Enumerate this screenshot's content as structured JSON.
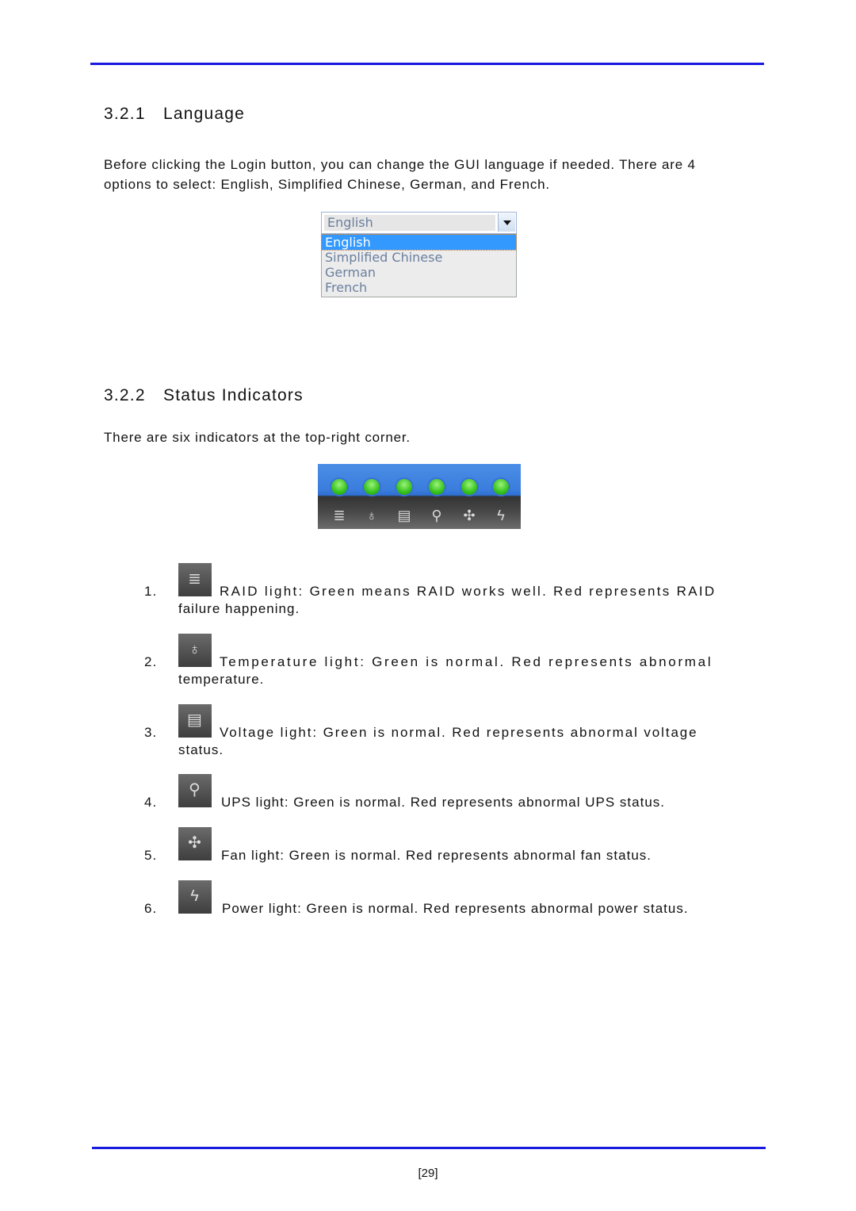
{
  "section_language": {
    "number": "3.2.1",
    "title": "Language",
    "paragraph": "Before clicking the Login button, you can change the GUI language if needed. There are 4 options to select: English, Simplified Chinese, German, and French.",
    "dropdown": {
      "selected": "English",
      "options": [
        "English",
        "Simplified Chinese",
        "German",
        "French"
      ],
      "highlighted_index": 0
    }
  },
  "section_status": {
    "number": "3.2.2",
    "title": "Status Indicators",
    "paragraph": "There are six indicators at the top-right corner.",
    "indicator_bar": {
      "lights": [
        {
          "name": "RAID",
          "icon": "raid-icon",
          "glyph": "≣",
          "status": "green"
        },
        {
          "name": "Temperature",
          "icon": "thermometer-icon",
          "glyph": "♁",
          "status": "green"
        },
        {
          "name": "Voltage",
          "icon": "battery-icon",
          "glyph": "▤",
          "status": "green"
        },
        {
          "name": "UPS",
          "icon": "plug-icon",
          "glyph": "⚲",
          "status": "green"
        },
        {
          "name": "Fan",
          "icon": "fan-icon",
          "glyph": "✣",
          "status": "green"
        },
        {
          "name": "Power",
          "icon": "power-icon",
          "glyph": "ϟ",
          "status": "green"
        }
      ],
      "colors": {
        "bar_blue": "#3a7ddd",
        "bar_dark": "#444444",
        "light_green": "#35c21b"
      }
    },
    "items": [
      {
        "number": "1.",
        "line1": "RAID light: Green means RAID works well. Red represents RAID",
        "line2": "failure happening.",
        "glyph": "≣"
      },
      {
        "number": "2.",
        "line1": "Temperature light: Green is normal. Red represents abnormal",
        "line2": "temperature.",
        "glyph": "♁"
      },
      {
        "number": "3.",
        "line1": "Voltage light: Green is normal. Red represents abnormal voltage",
        "line2": "status.",
        "glyph": "▤"
      },
      {
        "number": "4.",
        "line1": "UPS light: Green is normal. Red represents abnormal UPS status.",
        "glyph": "⚲"
      },
      {
        "number": "5.",
        "line1": "Fan light: Green is normal. Red represents abnormal fan status.",
        "glyph": "✣"
      },
      {
        "number": "6.",
        "line1": "Power light: Green is normal. Red represents abnormal power status.",
        "glyph": "ϟ"
      }
    ]
  },
  "footer": {
    "page_number": "[29]"
  },
  "colors": {
    "rule": "#1a1ae0"
  }
}
